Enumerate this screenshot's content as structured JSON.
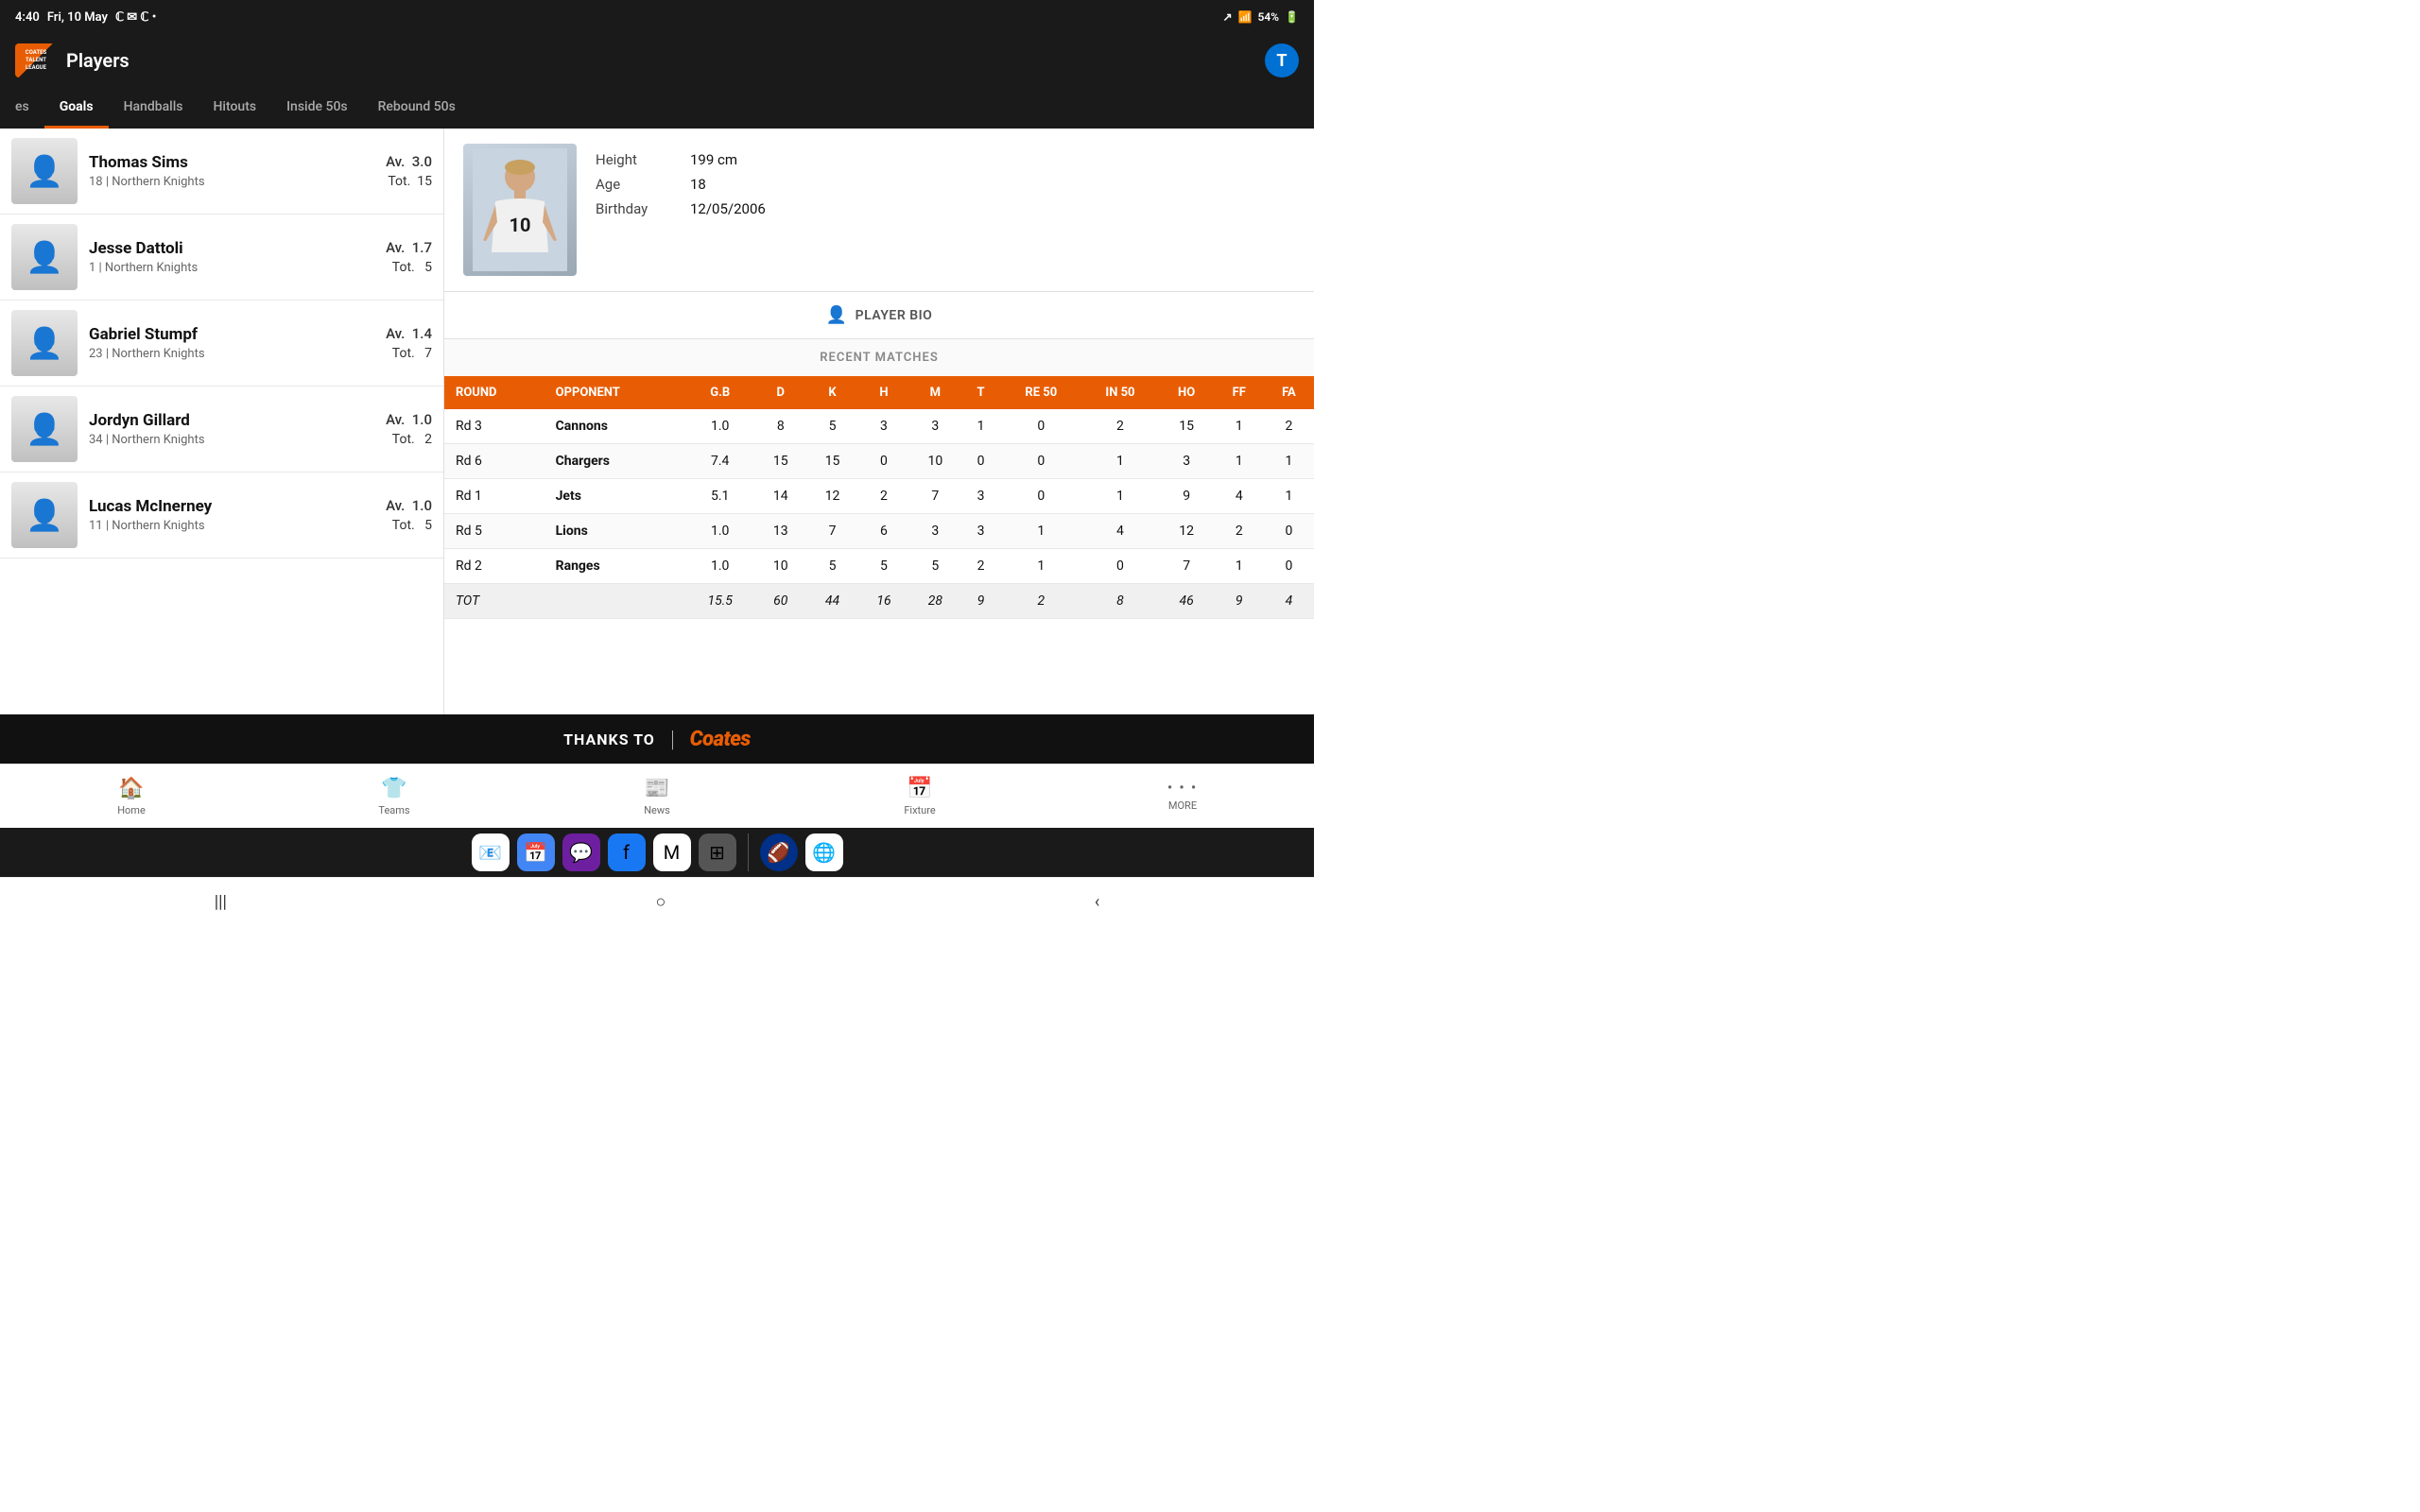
{
  "statusBar": {
    "time": "4:40",
    "date": "Fri, 10 May",
    "battery": "54%"
  },
  "header": {
    "title": "Players",
    "logoLine1": "COATES",
    "logoLine2": "TALENT",
    "logoLine3": "LEAGUE"
  },
  "tabs": [
    {
      "label": "es",
      "active": false
    },
    {
      "label": "Goals",
      "active": true
    },
    {
      "label": "Handballs",
      "active": false
    },
    {
      "label": "Hitouts",
      "active": false
    },
    {
      "label": "Inside 50s",
      "active": false
    },
    {
      "label": "Rebound 50s",
      "active": false
    }
  ],
  "players": [
    {
      "name": "Thomas Sims",
      "number": 18,
      "team": "Northern Knights",
      "av": "3.0",
      "tot": 15
    },
    {
      "name": "Jesse Dattoli",
      "number": 1,
      "team": "Northern Knights",
      "av": "1.7",
      "tot": 5
    },
    {
      "name": "Gabriel Stumpf",
      "number": 23,
      "team": "Northern Knights",
      "av": "1.4",
      "tot": 7
    },
    {
      "name": "Jordyn Gillard",
      "number": 34,
      "team": "Northern Knights",
      "av": "1.0",
      "tot": 2
    },
    {
      "name": "Lucas McInerney",
      "number": 11,
      "team": "Northern Knights",
      "av": "1.0",
      "tot": 5
    }
  ],
  "playerDetail": {
    "height": "199 cm",
    "age": 18,
    "birthday": "12/05/2006",
    "heightLabel": "Height",
    "ageLabel": "Age",
    "birthdayLabel": "Birthday",
    "bioBtnLabel": "PLAYER BIO",
    "recentMatchesHeader": "RECENT MATCHES"
  },
  "tableHeaders": [
    "ROUND",
    "OPPONENT",
    "G.B",
    "D",
    "K",
    "H",
    "M",
    "T",
    "RE 50",
    "IN 50",
    "HO",
    "FF",
    "FA"
  ],
  "matches": [
    {
      "round": "Rd 3",
      "opponent": "Cannons",
      "gb": "1.0",
      "d": 8,
      "k": 5,
      "h": 3,
      "m": 3,
      "t": 1,
      "re50": 0,
      "in50": 2,
      "ho": 15,
      "ff": 1,
      "fa": 2
    },
    {
      "round": "Rd 6",
      "opponent": "Chargers",
      "gb": "7.4",
      "d": 15,
      "k": 15,
      "h": 0,
      "m": 10,
      "t": 0,
      "re50": 0,
      "in50": 1,
      "ho": 3,
      "ff": 1,
      "fa": 1
    },
    {
      "round": "Rd 1",
      "opponent": "Jets",
      "gb": "5.1",
      "d": 14,
      "k": 12,
      "h": 2,
      "m": 7,
      "t": 3,
      "re50": 0,
      "in50": 1,
      "ho": 9,
      "ff": 4,
      "fa": 1
    },
    {
      "round": "Rd 5",
      "opponent": "Lions",
      "gb": "1.0",
      "d": 13,
      "k": 7,
      "h": 6,
      "m": 3,
      "t": 3,
      "re50": 1,
      "in50": 4,
      "ho": 12,
      "ff": 2,
      "fa": 0
    },
    {
      "round": "Rd 2",
      "opponent": "Ranges",
      "gb": "1.0",
      "d": 10,
      "k": 5,
      "h": 5,
      "m": 5,
      "t": 2,
      "re50": 1,
      "in50": 0,
      "ho": 7,
      "ff": 1,
      "fa": 0
    },
    {
      "round": "TOT",
      "opponent": "",
      "gb": "15.5",
      "d": 60,
      "k": 44,
      "h": 16,
      "m": 28,
      "t": 9,
      "re50": 2,
      "in50": 8,
      "ho": 46,
      "ff": 9,
      "fa": 4
    }
  ],
  "banner": {
    "thanksText": "THANKS TO",
    "brandName": "Coates"
  },
  "bottomNav": [
    {
      "label": "Home",
      "icon": "🏠"
    },
    {
      "label": "Teams",
      "icon": "👕"
    },
    {
      "label": "News",
      "icon": "📰"
    },
    {
      "label": "Fixture",
      "icon": "📅"
    },
    {
      "label": "MORE",
      "icon": "···"
    }
  ],
  "systemNav": {
    "menuIcon": "|||",
    "homeIcon": "○",
    "backIcon": "‹"
  }
}
